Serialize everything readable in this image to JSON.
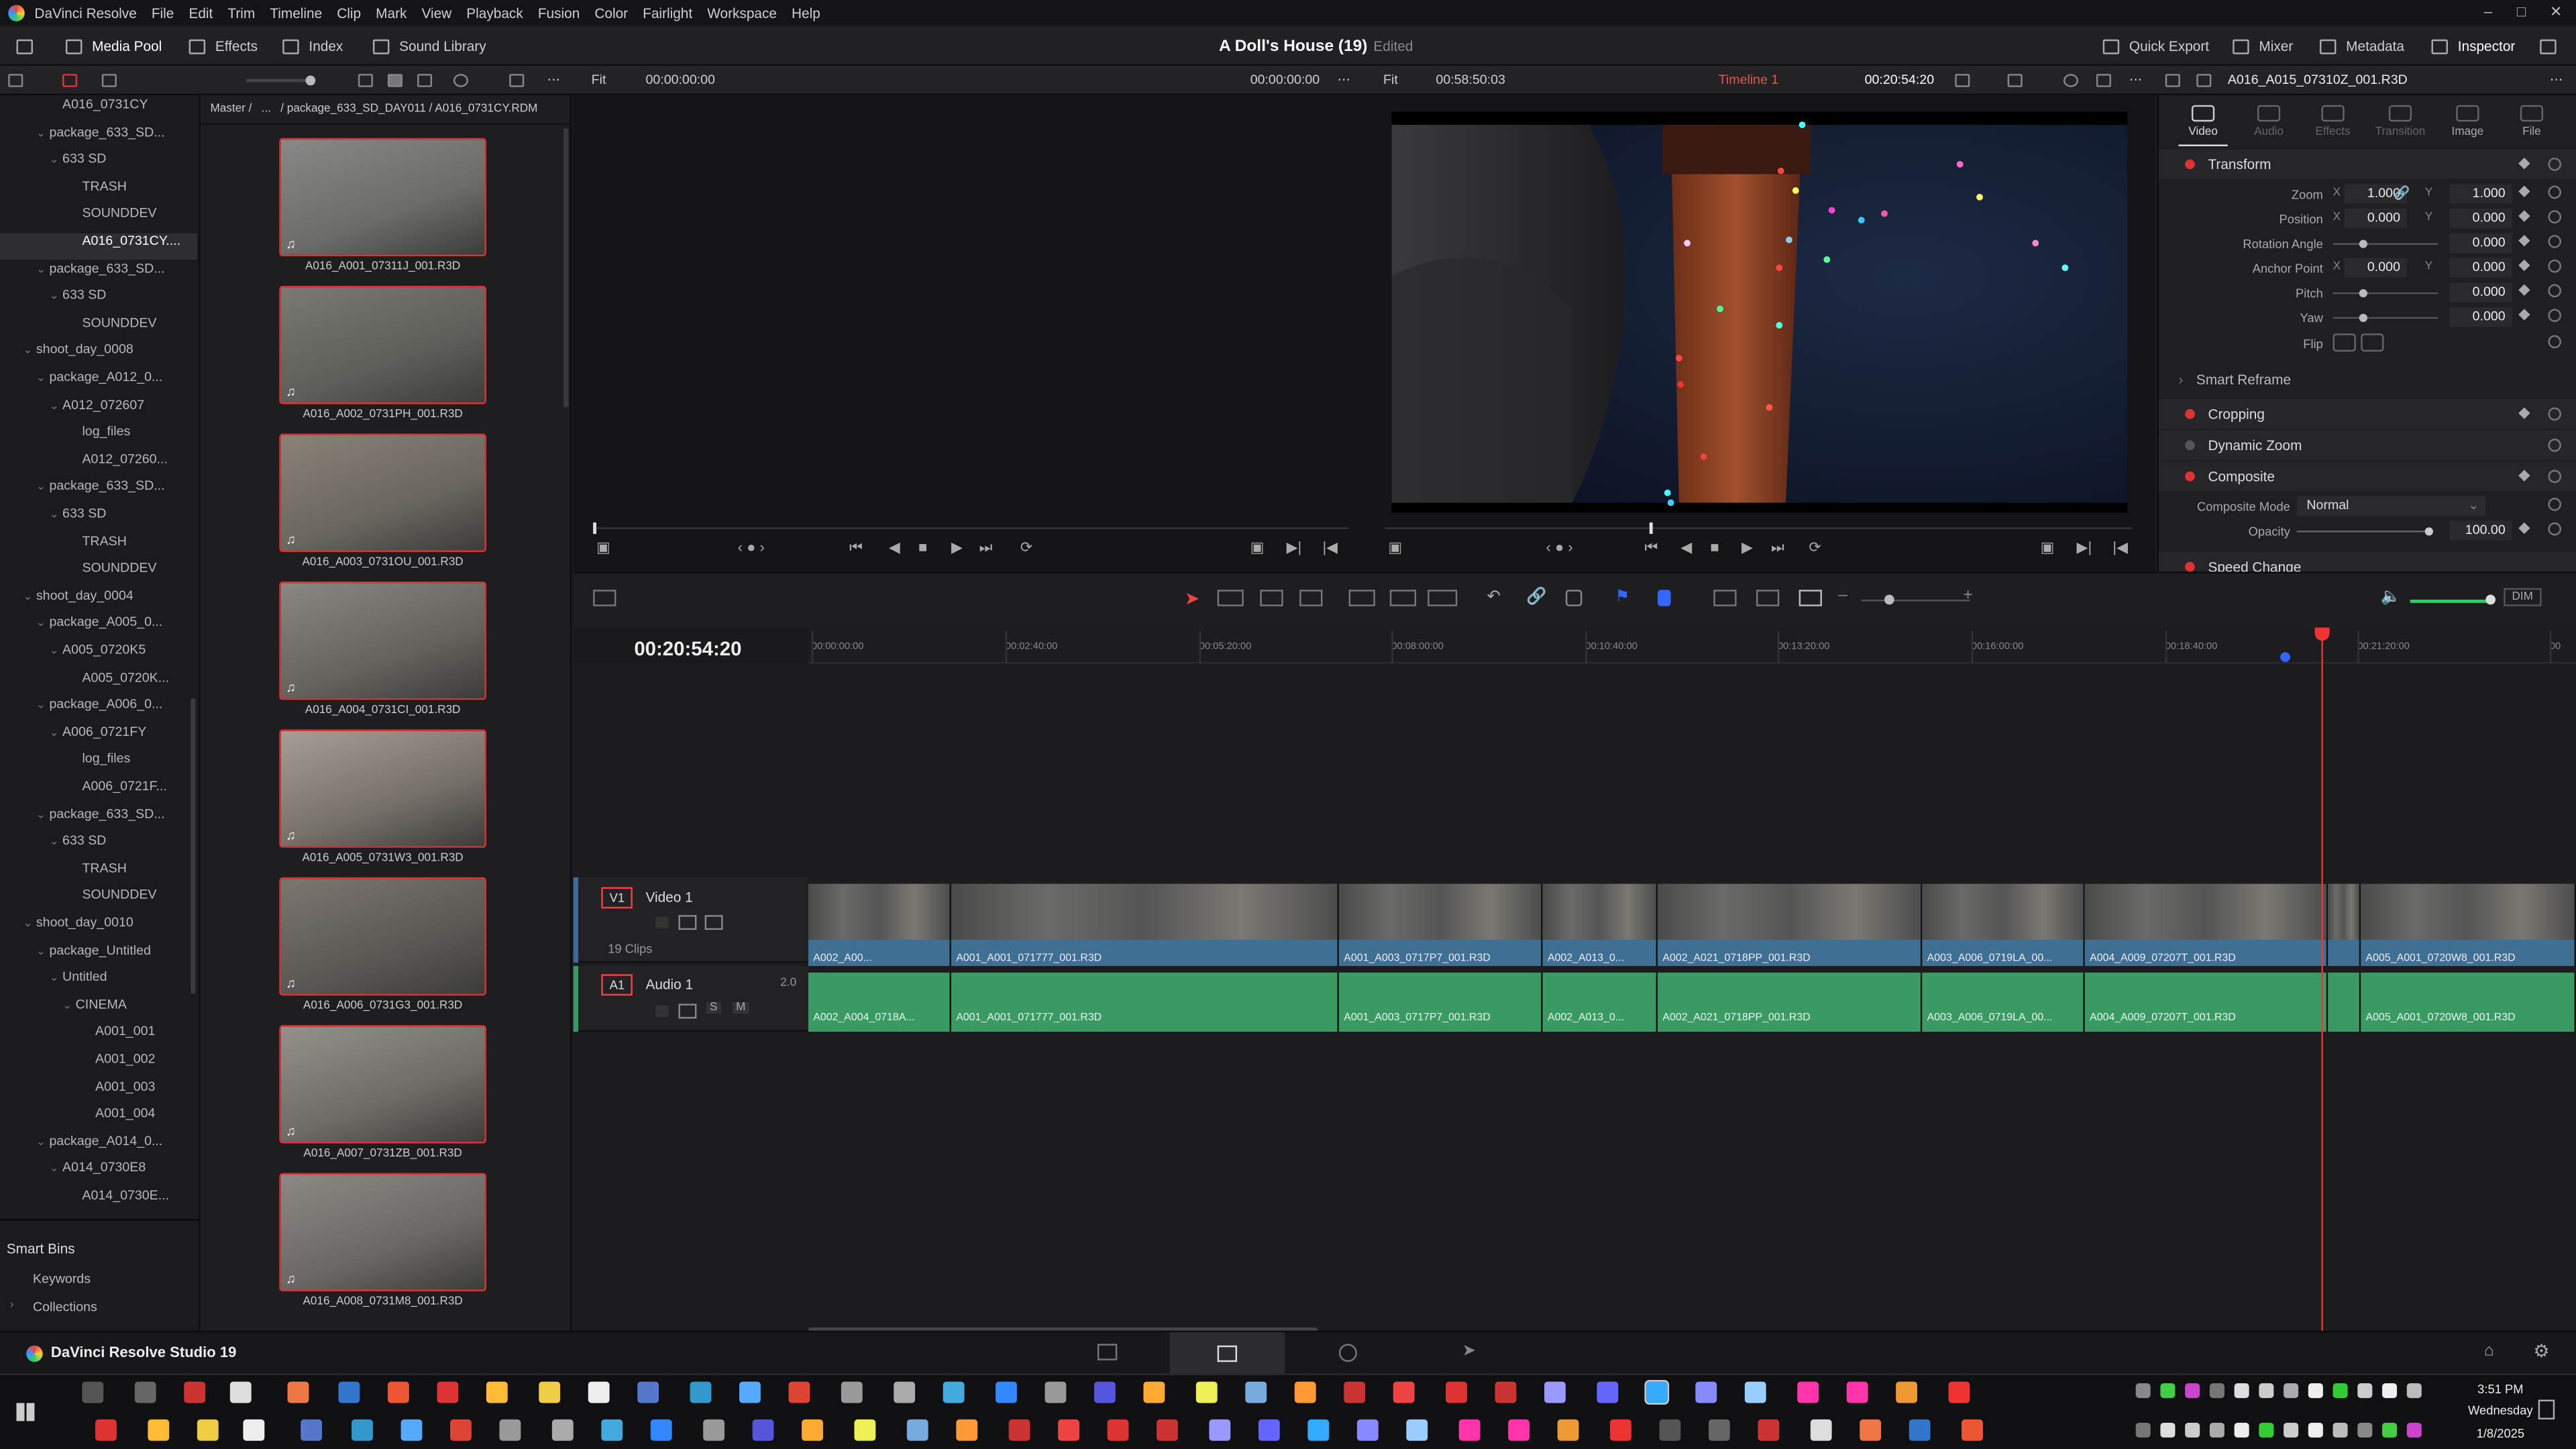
{
  "menu": {
    "app": "DaVinci Resolve",
    "items": [
      "File",
      "Edit",
      "Trim",
      "Timeline",
      "Clip",
      "Mark",
      "View",
      "Playback",
      "Fusion",
      "Color",
      "Fairlight",
      "Workspace",
      "Help"
    ]
  },
  "toolbar": {
    "media_pool": "Media Pool",
    "effects": "Effects",
    "index": "Index",
    "sound_library": "Sound Library",
    "project_title": "A Doll's House (19)",
    "edited": "Edited",
    "quick_export": "Quick Export",
    "mixer": "Mixer",
    "metadata": "Metadata",
    "inspector": "Inspector"
  },
  "source_bar": {
    "fit": "Fit",
    "timecode": "00:00:00:00",
    "timecode_right": "00:00:00:00"
  },
  "program_bar": {
    "fit": "Fit",
    "duration": "00:58:50:03",
    "timeline_name": "Timeline 1",
    "timecode": "00:20:54:20",
    "clip_name": "A016_A015_07310Z_001.R3D"
  },
  "breadcrumb": "Master /   ...   / package_633_SD_DAY011 / A016_0731CY.RDM",
  "tree": [
    {
      "t": "A016_0731CY",
      "d": 3,
      "ar": ""
    },
    {
      "t": "package_633_SD...",
      "d": 2,
      "ar": "v"
    },
    {
      "t": "633 SD",
      "d": 3,
      "ar": "v"
    },
    {
      "t": "TRASH",
      "d": 4,
      "ar": ""
    },
    {
      "t": "SOUNDDEV",
      "d": 4,
      "ar": ""
    },
    {
      "t": "A016_0731CY....",
      "d": 4,
      "ar": "",
      "sel": true
    },
    {
      "t": "package_633_SD...",
      "d": 2,
      "ar": "v"
    },
    {
      "t": "633 SD",
      "d": 3,
      "ar": "v"
    },
    {
      "t": "SOUNDDEV",
      "d": 4,
      "ar": ""
    },
    {
      "t": "shoot_day_0008",
      "d": 1,
      "ar": "v"
    },
    {
      "t": "package_A012_0...",
      "d": 2,
      "ar": "v"
    },
    {
      "t": "A012_072607",
      "d": 3,
      "ar": "v"
    },
    {
      "t": "log_files",
      "d": 4,
      "ar": ""
    },
    {
      "t": "A012_07260...",
      "d": 4,
      "ar": ""
    },
    {
      "t": "package_633_SD...",
      "d": 2,
      "ar": "v"
    },
    {
      "t": "633 SD",
      "d": 3,
      "ar": "v"
    },
    {
      "t": "TRASH",
      "d": 4,
      "ar": ""
    },
    {
      "t": "SOUNDDEV",
      "d": 4,
      "ar": ""
    },
    {
      "t": "shoot_day_0004",
      "d": 1,
      "ar": "v"
    },
    {
      "t": "package_A005_0...",
      "d": 2,
      "ar": "v"
    },
    {
      "t": "A005_0720K5",
      "d": 3,
      "ar": "v"
    },
    {
      "t": "A005_0720K...",
      "d": 4,
      "ar": ""
    },
    {
      "t": "package_A006_0...",
      "d": 2,
      "ar": "v"
    },
    {
      "t": "A006_0721FY",
      "d": 3,
      "ar": "v"
    },
    {
      "t": "log_files",
      "d": 4,
      "ar": ""
    },
    {
      "t": "A006_0721F...",
      "d": 4,
      "ar": ""
    },
    {
      "t": "package_633_SD...",
      "d": 2,
      "ar": "v"
    },
    {
      "t": "633 SD",
      "d": 3,
      "ar": "v"
    },
    {
      "t": "TRASH",
      "d": 4,
      "ar": ""
    },
    {
      "t": "SOUNDDEV",
      "d": 4,
      "ar": ""
    },
    {
      "t": "shoot_day_0010",
      "d": 1,
      "ar": "v"
    },
    {
      "t": "package_Untitled",
      "d": 2,
      "ar": "v"
    },
    {
      "t": "Untitled",
      "d": 3,
      "ar": "v"
    },
    {
      "t": "CINEMA",
      "d": 4,
      "ar": "v"
    },
    {
      "t": "A001_001",
      "d": 5,
      "ar": ""
    },
    {
      "t": "A001_002",
      "d": 5,
      "ar": ""
    },
    {
      "t": "A001_003",
      "d": 5,
      "ar": ""
    },
    {
      "t": "A001_004",
      "d": 5,
      "ar": ""
    },
    {
      "t": "package_A014_0...",
      "d": 2,
      "ar": "v"
    },
    {
      "t": "A014_0730E8",
      "d": 3,
      "ar": "v"
    },
    {
      "t": "A014_0730E...",
      "d": 4,
      "ar": ""
    }
  ],
  "smart": {
    "title": "Smart Bins",
    "keywords": "Keywords",
    "collections": "Collections"
  },
  "thumbs": [
    "A016_A001_07311J_001.R3D",
    "A016_A002_0731PH_001.R3D",
    "A016_A003_0731OU_001.R3D",
    "A016_A004_0731CI_001.R3D",
    "A016_A005_0731W3_001.R3D",
    "A016_A006_0731G3_001.R3D",
    "A016_A007_0731ZB_001.R3D",
    "A016_A008_0731M8_001.R3D"
  ],
  "inspector": {
    "tabs": [
      "Video",
      "Audio",
      "Effects",
      "Transition",
      "Image",
      "File"
    ],
    "transform": "Transform",
    "zoom": "Zoom",
    "zoom_x": "1.000",
    "zoom_y": "1.000",
    "position": "Position",
    "pos_x": "0.000",
    "pos_y": "0.000",
    "rotation": "Rotation Angle",
    "rotation_v": "0.000",
    "anchor": "Anchor Point",
    "anchor_x": "0.000",
    "anchor_y": "0.000",
    "pitch": "Pitch",
    "pitch_v": "0.000",
    "yaw": "Yaw",
    "yaw_v": "0.000",
    "flip": "Flip",
    "x": "X",
    "y": "Y",
    "smart_reframe": "Smart Reframe",
    "cropping": "Cropping",
    "dynamic_zoom": "Dynamic Zoom",
    "composite": "Composite",
    "composite_mode": "Composite Mode",
    "composite_mode_v": "Normal",
    "opacity": "Opacity",
    "opacity_v": "100.00",
    "speed_change": "Speed Change"
  },
  "timeline": {
    "timecode": "00:20:54:20",
    "ruler": [
      "00:00:00:00",
      "00:02:40:00",
      "00:05:20:00",
      "00:08:00:00",
      "00:10:40:00",
      "00:13:20:00",
      "00:16:00:00",
      "00:18:40:00",
      "00:21:20:00",
      "00"
    ],
    "v1_badge": "V1",
    "v1_name": "Video 1",
    "v1_clips": "19 Clips",
    "a1_badge": "A1",
    "a1_name": "Audio 1",
    "a1_level": "2.0",
    "a1_s": "S",
    "a1_m": "M",
    "video_clips": [
      "A002_A00...",
      "A001_A001_071777_001.R3D",
      "A001_A003_0717P7_001.R3D",
      "A002_A013_0...",
      "A002_A021_0718PP_001.R3D",
      "A003_A006_0719LA_00...",
      "A004_A009_07207T_001.R3D",
      "",
      "A005_A001_0720W8_001.R3D"
    ],
    "audio_clips": [
      "A002_A004_0718A...",
      "A001_A001_071777_001.R3D",
      "A001_A003_0717P7_001.R3D",
      "A002_A013_0...",
      "A002_A021_0718PP_001.R3D",
      "A003_A006_0719LA_00...",
      "A004_A009_07207T_001.R3D",
      "",
      "A005_A001_0720W8_001.R3D"
    ],
    "dim": "DIM"
  },
  "footer": {
    "app_name": "DaVinci Resolve Studio 19"
  },
  "taskbar": {
    "time": "3:51 PM",
    "day": "Wednesday",
    "date": "1/8/2025"
  }
}
